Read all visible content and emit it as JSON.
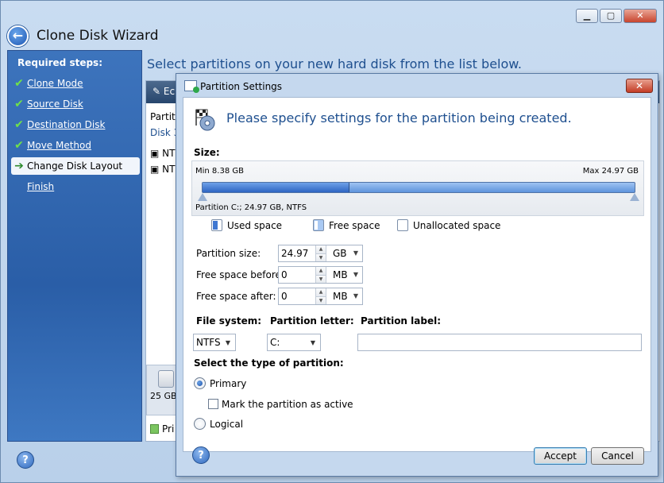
{
  "window": {
    "title": "Clone Disk Wizard",
    "instruction": "Select partitions on your new hard disk from the list below."
  },
  "sidebar": {
    "heading": "Required steps:",
    "items": [
      {
        "label": "Clone Mode",
        "done": true
      },
      {
        "label": "Source Disk",
        "done": true
      },
      {
        "label": "Destination Disk",
        "done": true
      },
      {
        "label": "Move Method",
        "done": true
      },
      {
        "label": "Change Disk Layout",
        "current": true
      },
      {
        "label": "Finish"
      }
    ]
  },
  "background": {
    "toolbar_text": "Ec",
    "column": "Partiti",
    "disk": "Disk 3",
    "rows": [
      "NTI",
      "NTI"
    ],
    "disk_size": "25 GB",
    "legend": "Pri"
  },
  "dialog": {
    "title": "Partition Settings",
    "close": "✕",
    "header": "Please specify settings for the partition being created.",
    "size_label": "Size:",
    "slider": {
      "min": "Min 8.38 GB",
      "max": "Max 24.97 GB",
      "partition_info": "Partition C:; 24.97 GB, NTFS",
      "used_fraction": 0.34
    },
    "legend": {
      "used": "Used space",
      "free": "Free space",
      "unallocated": "Unallocated space"
    },
    "fields": {
      "partition_size": {
        "label": "Partition size:",
        "value": "24.97",
        "unit": "GB"
      },
      "free_before": {
        "label": "Free space before:",
        "value": "0",
        "unit": "MB"
      },
      "free_after": {
        "label": "Free space after:",
        "value": "0",
        "unit": "MB"
      }
    },
    "file_system": {
      "label": "File system:",
      "value": "NTFS"
    },
    "partition_letter": {
      "label": "Partition letter:",
      "value": "C:"
    },
    "partition_label": {
      "label": "Partition label:",
      "value": ""
    },
    "type_heading": "Select the type of partition:",
    "primary": "Primary",
    "mark_active": "Mark the partition as active",
    "logical": "Logical",
    "accept": "Accept",
    "cancel": "Cancel"
  },
  "colors": {
    "accent_text": "#1e4f8f",
    "sidebar": "#2a5ea7",
    "slider_used": "#2e64c2"
  }
}
